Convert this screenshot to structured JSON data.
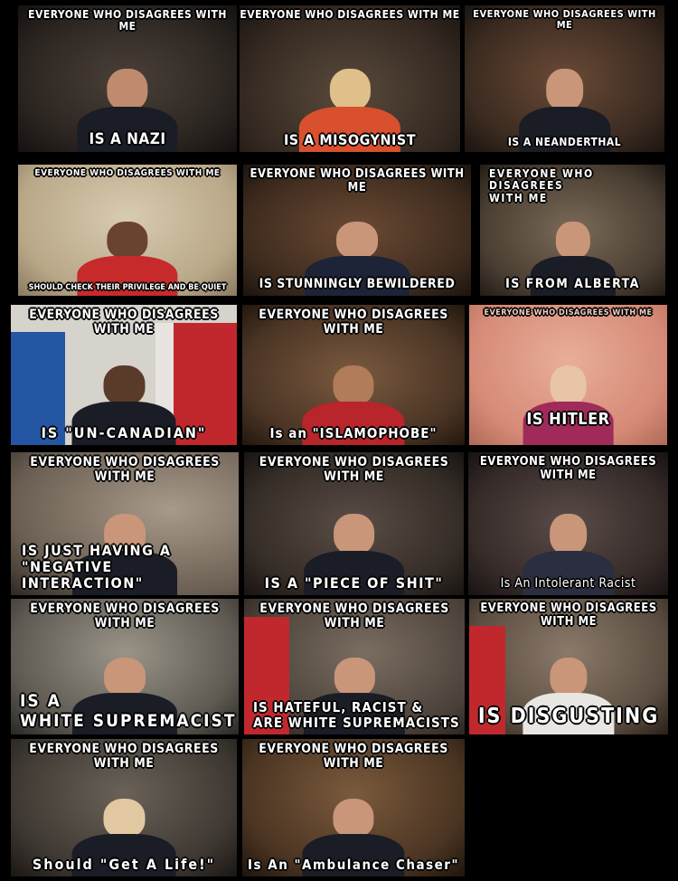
{
  "panels": [
    {
      "top": "EVERYONE WHO DISAGREES WITH ME",
      "bottom": "IS A NAZI"
    },
    {
      "top": "EVERYONE WHO DISAGREES WITH ME",
      "bottom": "IS A MISOGYNIST"
    },
    {
      "top": "EVERYONE WHO DISAGREES WITH ME",
      "bottom": "IS A NEANDERTHAL"
    },
    {
      "top": "EVERYONE WHO DISAGREES WITH ME",
      "bottom": "SHOULD CHECK THEIR PRIVILEGE AND BE QUIET"
    },
    {
      "top": "EVERYONE WHO DISAGREES WITH ME",
      "bottom": "IS STUNNINGLY BEWILDERED"
    },
    {
      "top": "EVERYONE WHO DISAGREES\nWITH ME",
      "bottom": "IS FROM ALBERTA"
    },
    {
      "top": "EVERYONE WHO DISAGREES WITH ME",
      "bottom": "IS \"UN-CANADIAN\""
    },
    {
      "top": "EVERYONE WHO DISAGREES WITH ME",
      "bottom": "Is an \"ISLAMOPHOBE\""
    },
    {
      "top": "EVERYONE WHO DISAGREES WITH ME",
      "bottom": "IS HITLER"
    },
    {
      "top": "EVERYONE WHO DISAGREES WITH ME",
      "bottom": "IS JUST HAVING A\n\"NEGATIVE INTERACTION\""
    },
    {
      "top": "EVERYONE WHO DISAGREES WITH ME",
      "bottom": "IS A \"PIECE OF SHIT\""
    },
    {
      "top": "EVERYONE WHO DISAGREES WITH ME",
      "bottom": "Is An Intolerant Racist"
    },
    {
      "top": "EVERYONE WHO DISAGREES WITH ME",
      "bottom": "IS A\nWHITE SUPREMACIST"
    },
    {
      "top": "EVERYONE WHO DISAGREES WITH ME",
      "bottom": "IS HATEFUL, RACIST &\nARE WHITE SUPREMACISTS"
    },
    {
      "top": "EVERYONE WHO DISAGREES WITH ME",
      "bottom": "IS DISGUSTING"
    },
    {
      "top": "EVERYONE WHO DISAGREES WITH ME",
      "bottom": "Should \"Get A Life!\""
    },
    {
      "top": "EVERYONE WHO DISAGREES WITH ME",
      "bottom": "Is An \"Ambulance Chaser\""
    }
  ],
  "colors": {
    "background": "#000000",
    "caption": "#ffffff",
    "flag_red": "#c0282d",
    "flag_blue": "#2456a3"
  }
}
